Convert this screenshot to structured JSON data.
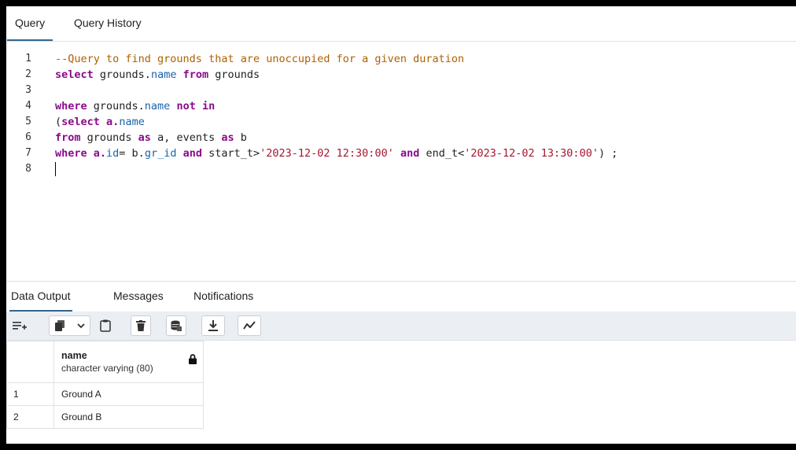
{
  "tabs": {
    "query": "Query",
    "history": "Query History"
  },
  "editor": {
    "line_numbers": [
      "1",
      "2",
      "3",
      "4",
      "5",
      "6",
      "7",
      "8"
    ],
    "line1": "--Query to find grounds that are unoccupied for a given duration",
    "line2_kw1": "select",
    "line2_a": " grounds.",
    "line2_prop": "name",
    "line2_kw2": " from",
    "line2_b": " grounds",
    "line4_kw1": "where",
    "line4_a": " grounds.",
    "line4_prop": "name",
    "line4_kw2": " not in",
    "line5_a": "(",
    "line5_kw": "select",
    "line5_b": " a.",
    "line5_prop": "name",
    "line6_kw1": "from",
    "line6_a": " grounds ",
    "line6_kw2": "as",
    "line6_b": " a, events ",
    "line6_kw3": "as",
    "line6_c": " b",
    "line7_kw1": "where",
    "line7_a": " a.",
    "line7_prop1": "id",
    "line7_b": "= b.",
    "line7_prop2": "gr_id",
    "line7_c": " ",
    "line7_kw2": "and",
    "line7_d": " start_t>",
    "line7_str1": "'2023-12-02 12:30:00'",
    "line7_e": " ",
    "line7_kw3": "and",
    "line7_f": " end_t<",
    "line7_str2": "'2023-12-02 13:30:00'",
    "line7_g": ") ;"
  },
  "bottom_tabs": {
    "data_output": "Data Output",
    "messages": "Messages",
    "notifications": "Notifications"
  },
  "toolbar_icons": [
    "add-row-icon",
    "copy-icon",
    "chevron-down-icon",
    "paste-icon",
    "delete-icon",
    "save-data-icon",
    "download-icon",
    "graph-icon"
  ],
  "results": {
    "column_name": "name",
    "column_type": "character varying (80)",
    "rows": [
      {
        "num": "1",
        "name": "Ground A"
      },
      {
        "num": "2",
        "name": "Ground B"
      }
    ]
  }
}
